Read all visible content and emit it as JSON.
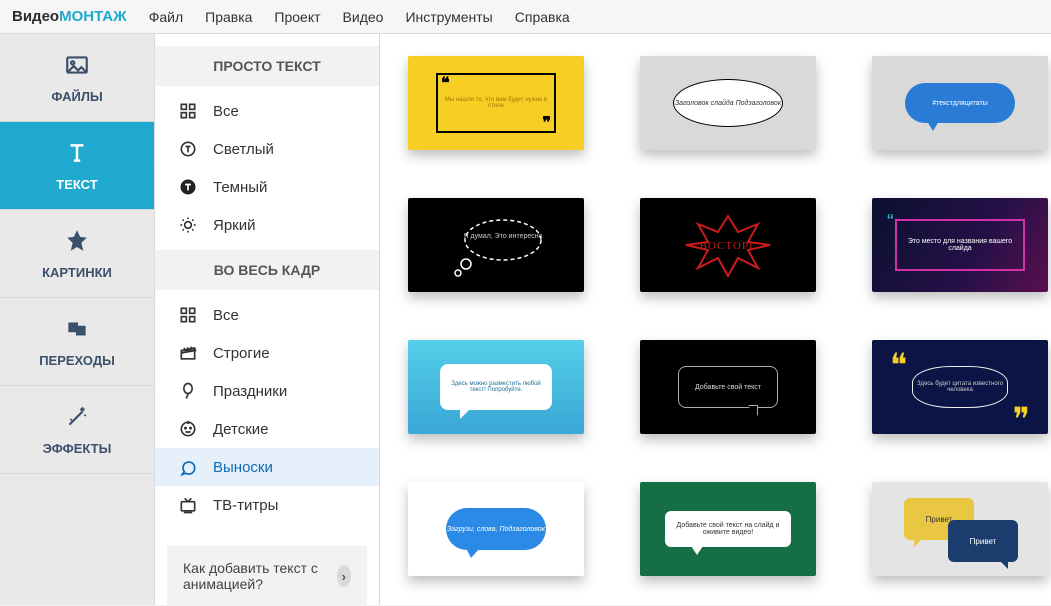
{
  "logo": {
    "part1": "Видео",
    "part2": "МОНТАЖ"
  },
  "menu": {
    "file": "Файл",
    "edit": "Правка",
    "project": "Проект",
    "video": "Видео",
    "tools": "Инструменты",
    "help": "Справка"
  },
  "nav": {
    "files": "ФАЙЛЫ",
    "text": "ТЕКСТ",
    "pictures": "КАРТИНКИ",
    "transitions": "ПЕРЕХОДЫ",
    "effects": "ЭФФЕКТЫ",
    "active": "text"
  },
  "panel": {
    "group1_title": "ПРОСТО ТЕКСТ",
    "group1": {
      "all": "Все",
      "light": "Светлый",
      "dark": "Темный",
      "bright": "Яркий"
    },
    "group2_title": "ВО ВЕСЬ КАДР",
    "group2": {
      "all": "Все",
      "strict": "Строгие",
      "holidays": "Праздники",
      "kids": "Детские",
      "callouts": "Выноски",
      "tvtitles": "ТВ-титры"
    },
    "help": "Как добавить текст с анимацией?",
    "active": "callouts"
  },
  "thumbs": {
    "t1": "Мы нашли то, что вам будет нужно в стиле",
    "t2": "Заголовок слайда Подзаголовок",
    "t3": "#текстдляцитаты",
    "t4": "Я думал, Это интересно",
    "t5": "ВОСТОРГ",
    "t6": "Это место для названия вашего слайда",
    "t7": "Здесь можно разместить любой текст! Попробуйте.",
    "t8": "Добавьте свой текст",
    "t9": "Здесь будет цитата известного человека",
    "t10": "Загрузи, слова, Подзаголовок",
    "t11": "Добавьте свой текст на слайд и оживите видео!",
    "t12a": "Привет",
    "t12b": "Привет"
  }
}
